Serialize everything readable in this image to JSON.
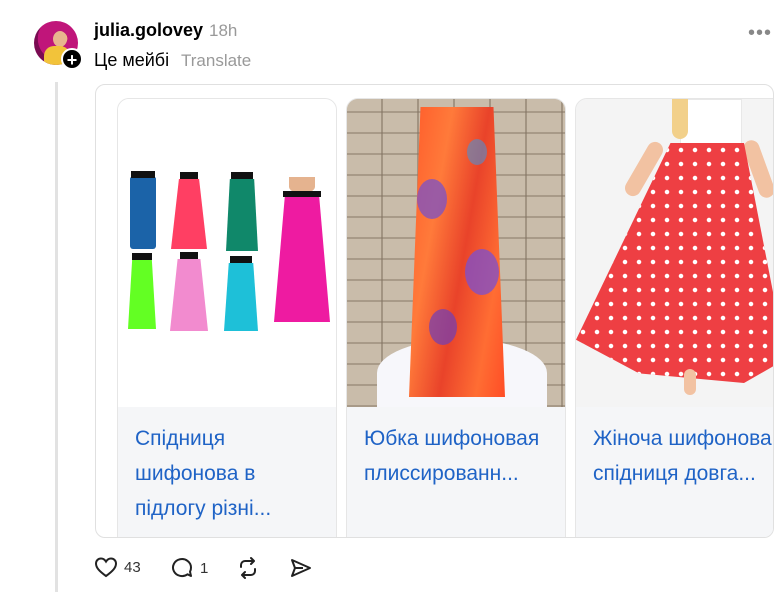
{
  "post": {
    "username": "julia.golovey",
    "time": "18h",
    "text": "Це мейбі",
    "translate_label": "Translate",
    "more_icon": "more-dots-icon"
  },
  "cards": [
    {
      "title": "Спідниця шифонова в підлогу різні...",
      "image": "six colorful maxi skirts"
    },
    {
      "title": "Юбка шифоновая плиссированн...",
      "image": "orange floral pleated skirt"
    },
    {
      "title": "Жіноча шифонова спідниця довга...",
      "image": "red polka dot maxi skirt"
    }
  ],
  "actions": {
    "likes": "43",
    "comments": "1",
    "like_icon": "heart-icon",
    "comment_icon": "comment-icon",
    "repost_icon": "repost-icon",
    "share_icon": "send-icon"
  },
  "colors": {
    "link": "#1f63c6",
    "muted": "#999999",
    "line": "#e2e2e2"
  }
}
